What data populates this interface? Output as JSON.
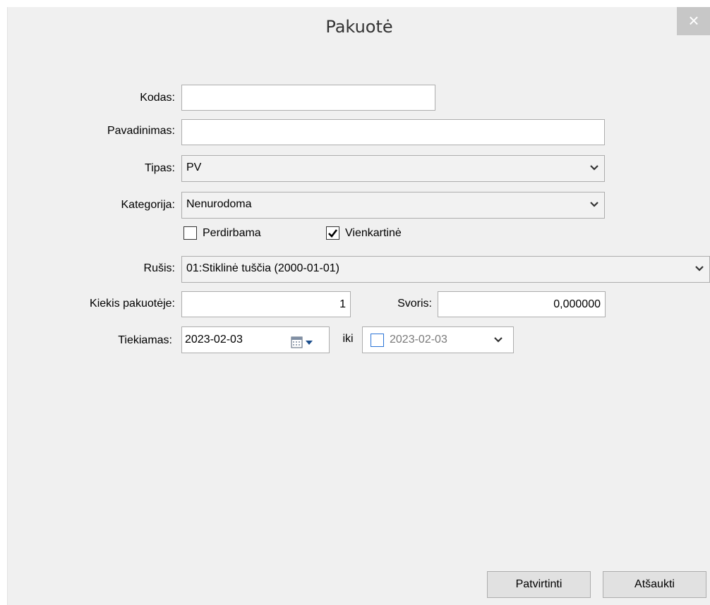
{
  "window": {
    "title": "Pakuotė",
    "close_glyph": "×"
  },
  "form": {
    "kodas": {
      "label": "Kodas:",
      "value": ""
    },
    "pavadinimas": {
      "label": "Pavadinimas:",
      "value": ""
    },
    "tipas": {
      "label": "Tipas:",
      "value": "PV"
    },
    "kategorija": {
      "label": "Kategorija:",
      "value": "Nenurodoma"
    },
    "perdirbama": {
      "label": "Perdirbama",
      "checked": false
    },
    "vienkartine": {
      "label": "Vienkartinė",
      "checked": true
    },
    "rusis": {
      "label": "Rušis:",
      "value": "01:Stiklinė tuščia (2000-01-01)"
    },
    "kiekis": {
      "label": "Kiekis pakuotėje:",
      "value": "1"
    },
    "svoris": {
      "label": "Svoris:",
      "value": "0,000000"
    },
    "tiekiamas": {
      "label": "Tiekiamas:",
      "from": "2023-02-03",
      "iki_label": "iki",
      "to": "2023-02-03",
      "to_enabled": false
    }
  },
  "buttons": {
    "confirm": "Patvirtinti",
    "cancel": "Atšaukti"
  },
  "icons": {
    "close": "close-icon",
    "calendar": "calendar-icon",
    "dropdown": "chevron-down-icon"
  }
}
